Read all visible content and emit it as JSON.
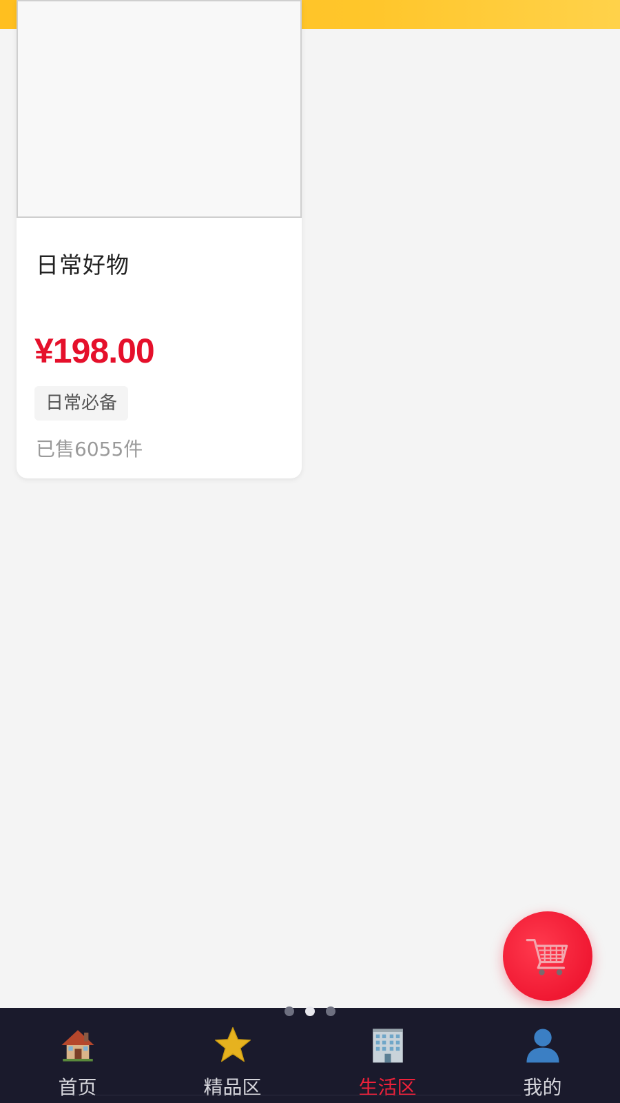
{
  "product": {
    "title": "日常好物",
    "price": "¥198.00",
    "tag": "日常必备",
    "sold": "已售6055件"
  },
  "fab": {
    "icon": "shopping-cart-icon"
  },
  "pager": {
    "total": 3,
    "active_index": 1
  },
  "nav": {
    "items": [
      {
        "label": "首页",
        "icon": "house-icon",
        "active": false
      },
      {
        "label": "精品区",
        "icon": "star-icon",
        "active": false
      },
      {
        "label": "生活区",
        "icon": "building-icon",
        "active": true
      },
      {
        "label": "我的",
        "icon": "user-icon",
        "active": false
      }
    ]
  },
  "colors": {
    "accent": "#e5102b",
    "top_bar": "#ffc62b",
    "nav_bg": "#1a1a2c",
    "fab": "#f01832"
  }
}
